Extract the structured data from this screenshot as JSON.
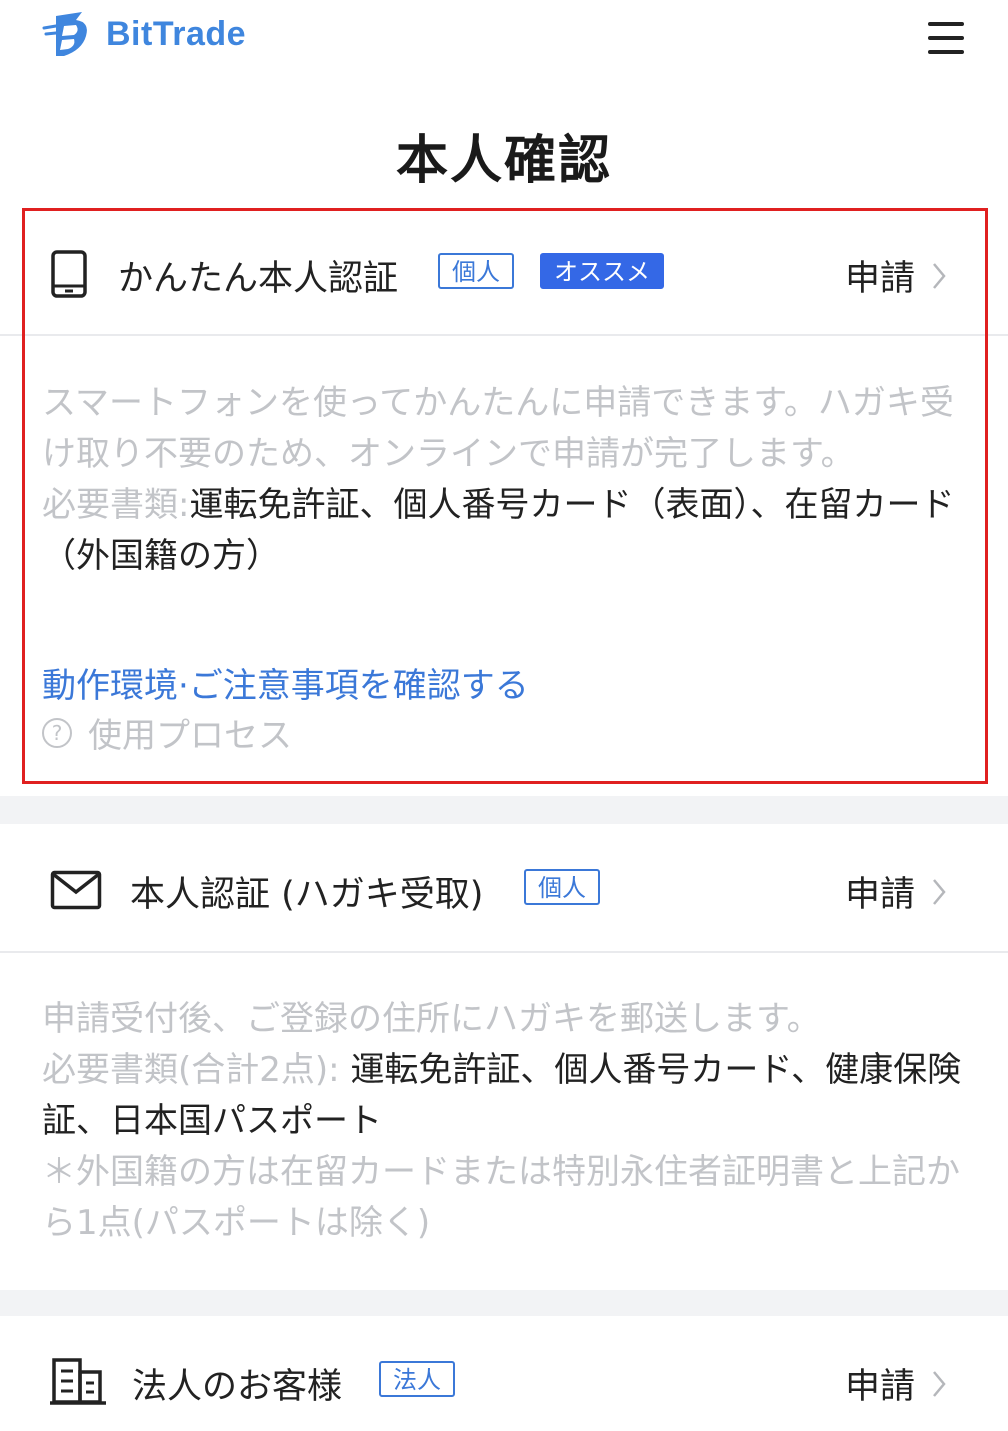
{
  "header": {
    "brand": "BitTrade",
    "menu_icon": "hamburger-menu-icon"
  },
  "page": {
    "title": "本人確認"
  },
  "colors": {
    "accent": "#3b78d8",
    "highlight_border": "#e02020",
    "muted_text": "#c2c4c8"
  },
  "sections": [
    {
      "icon": "smartphone-icon",
      "title": "かんたん本人認証",
      "tags": [
        "個人",
        "オススメ"
      ],
      "apply_label": "申請",
      "description": "スマートフォンを使ってかんたんに申請できます。ハガキ受け取り不要のため、オンラインで申請が完了します。",
      "docs_label": "必要書類:",
      "docs_value": "運転免許証、個人番号カード（表面）、在留カード（外国籍の方）",
      "link": "動作環境·ご注意事項を確認する",
      "help": "使用プロセス",
      "help_icon_glyph": "?"
    },
    {
      "icon": "envelope-icon",
      "title": "本人認証 (ハガキ受取)",
      "tags": [
        "個人"
      ],
      "apply_label": "申請",
      "description": "申請受付後、ご登録の住所にハガキを郵送します。",
      "docs_label": "必要書類(合計2点): ",
      "docs_value": "運転免許証、個人番号カード、健康保険証、日本国パスポート",
      "note": "＊外国籍の方は在留カードまたは特別永住者証明書と上記から1点(パスポートは除く)"
    },
    {
      "icon": "building-icon",
      "title": "法人のお客様",
      "tags": [
        "法人"
      ],
      "apply_label": "申請"
    }
  ]
}
